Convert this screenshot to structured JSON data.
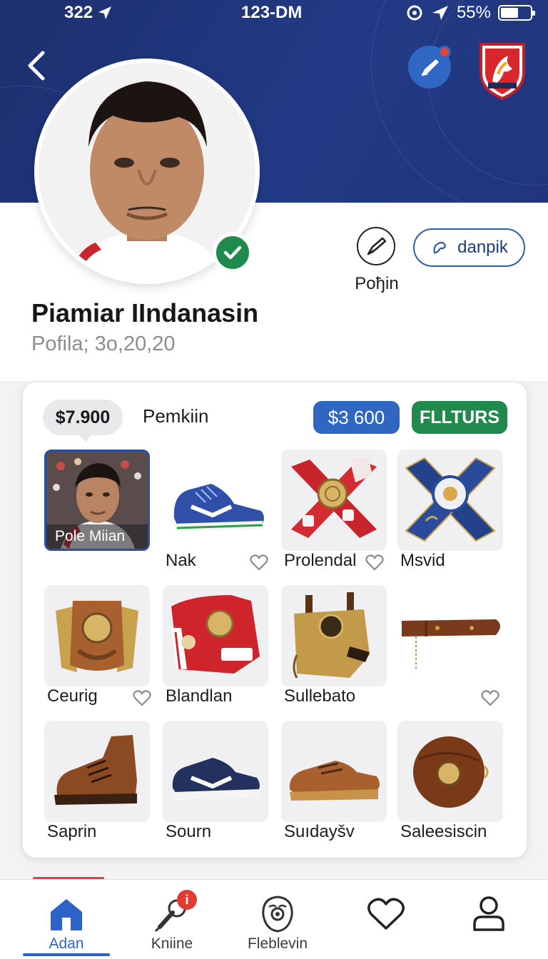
{
  "status_bar": {
    "left_number": "322",
    "time": "123-DM",
    "battery": "55%",
    "battery_fraction": 0.55
  },
  "header": {
    "back_icon": "chevron-left-icon",
    "edit_icon": "pen-icon",
    "crest_icon": "club-crest-icon"
  },
  "profile": {
    "name": "Piamiar IIndanasin",
    "subtitle": "Pofila; 3o,20,20",
    "verified_icon": "check-icon"
  },
  "actions": {
    "pin_label": "Poђin",
    "outline_button_label": "danpik",
    "pin_icon": "pin-check-icon",
    "outline_icon": "hand-icon"
  },
  "card": {
    "price_bubble": "$7.900",
    "title": "Pemkiin",
    "blue_pill": "$3 600",
    "green_pill": "FLLTURS",
    "items": [
      {
        "label": "Pole Miian",
        "icon": "player-photo"
      },
      {
        "label": "Nak",
        "icon": "sneaker-icon"
      },
      {
        "label": "Prolendal",
        "icon": "red-scarf-medal-icon"
      },
      {
        "label": "Msvid",
        "icon": "blue-scarf-medal-icon"
      },
      {
        "label": "Ceurig",
        "icon": "leather-medal-icon"
      },
      {
        "label": "Blandlan",
        "icon": "red-shirt-icon"
      },
      {
        "label": "Sullebato",
        "icon": "leather-bag-icon"
      },
      {
        "label": "",
        "icon": "leather-strap-icon"
      },
      {
        "label": "Saprin",
        "icon": "brown-boot-icon"
      },
      {
        "label": "Sourn",
        "icon": "navy-sneaker-icon"
      },
      {
        "label": "Suıdayšv",
        "icon": "brown-shoe-icon"
      },
      {
        "label": "Saleesiscin",
        "icon": "leather-ball-icon"
      }
    ]
  },
  "tabbar": {
    "tabs": [
      {
        "label": "Adan",
        "icon": "home-icon",
        "active": true
      },
      {
        "label": "Kniine",
        "icon": "microphone-icon",
        "badge": "i"
      },
      {
        "label": "Fleblevin",
        "icon": "alien-mask-icon"
      },
      {
        "label": "",
        "icon": "heart-icon"
      },
      {
        "label": "",
        "icon": "user-icon"
      }
    ]
  },
  "colors": {
    "hero": "#223a86",
    "primary_blue": "#2f66c2",
    "green": "#1f8a4c",
    "red": "#e4453a"
  }
}
